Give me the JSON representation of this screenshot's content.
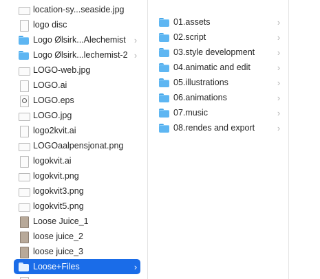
{
  "column1": {
    "items": [
      {
        "label": "location-sy...seaside.jpg",
        "icon": "image-file-icon",
        "chevron": false
      },
      {
        "label": "logo disc",
        "icon": "document-icon",
        "chevron": false
      },
      {
        "label": "Logo Ølsirk...Alechemist",
        "icon": "folder-icon",
        "chevron": true
      },
      {
        "label": "Logo Ølsirk...lechemist-2",
        "icon": "folder-icon",
        "chevron": true
      },
      {
        "label": "LOGO-web.jpg",
        "icon": "image-file-icon",
        "chevron": false
      },
      {
        "label": "LOGO.ai",
        "icon": "document-icon",
        "chevron": false
      },
      {
        "label": "LOGO.eps",
        "icon": "eps-file-icon",
        "chevron": false
      },
      {
        "label": "LOGO.jpg",
        "icon": "image-file-icon",
        "chevron": false
      },
      {
        "label": "logo2kvit.ai",
        "icon": "document-icon",
        "chevron": false
      },
      {
        "label": "LOGOaalpensjonat.png",
        "icon": "image-file-icon",
        "chevron": false
      },
      {
        "label": "logokvit.ai",
        "icon": "document-icon",
        "chevron": false
      },
      {
        "label": "logokvit.png",
        "icon": "image-file-icon",
        "chevron": false
      },
      {
        "label": "logokvit3.png",
        "icon": "image-file-icon",
        "chevron": false
      },
      {
        "label": "logokvit5.png",
        "icon": "image-file-icon",
        "chevron": false
      },
      {
        "label": "Loose Juice_1",
        "icon": "image-thumbnail-icon",
        "chevron": false
      },
      {
        "label": "loose juice_2",
        "icon": "image-thumbnail-icon",
        "chevron": false
      },
      {
        "label": "loose juice_3",
        "icon": "image-thumbnail-icon",
        "chevron": false
      },
      {
        "label": "Loose+Files",
        "icon": "folder-icon",
        "chevron": true,
        "selected": true
      },
      {
        "label": "",
        "icon": "document-icon",
        "chevron": false
      }
    ]
  },
  "column2": {
    "items": [
      {
        "label": "01.assets",
        "icon": "folder-icon",
        "chevron": true
      },
      {
        "label": "02.script",
        "icon": "folder-icon",
        "chevron": true
      },
      {
        "label": "03.style development",
        "icon": "folder-icon",
        "chevron": true
      },
      {
        "label": "04.animatic and edit",
        "icon": "folder-icon",
        "chevron": true
      },
      {
        "label": "05.illustrations",
        "icon": "folder-icon",
        "chevron": true
      },
      {
        "label": "06.animations",
        "icon": "folder-icon",
        "chevron": true
      },
      {
        "label": "07.music",
        "icon": "folder-icon",
        "chevron": true
      },
      {
        "label": "08.rendes and export",
        "icon": "folder-icon",
        "chevron": true
      }
    ]
  },
  "chevron_glyph": "›",
  "colors": {
    "selection": "#1a6ce8",
    "folder": "#5eb6f2"
  }
}
